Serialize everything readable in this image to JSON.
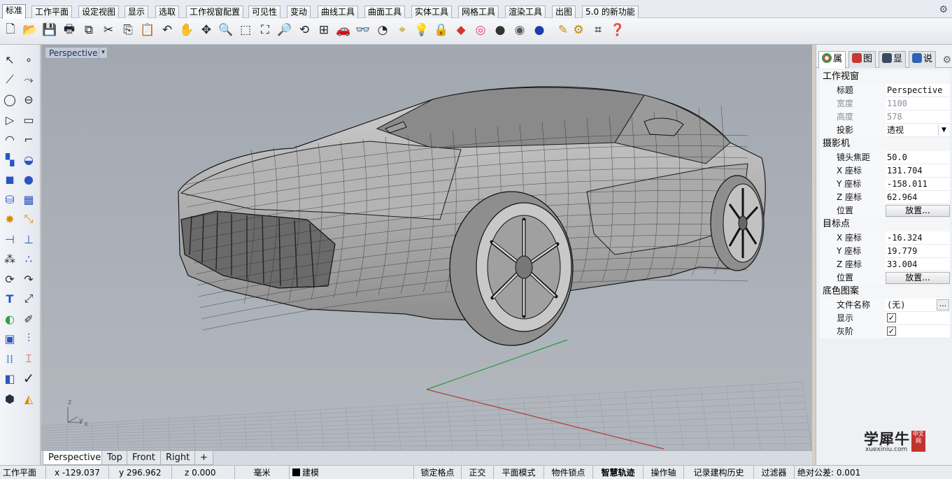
{
  "menu_tabs": [
    {
      "label": "标准",
      "active": true
    },
    {
      "label": "工作平面"
    },
    {
      "label": "设定视图"
    },
    {
      "label": "显示"
    },
    {
      "label": "选取"
    },
    {
      "label": "工作视窗配置"
    },
    {
      "label": "可见性"
    },
    {
      "label": "变动"
    },
    {
      "label": "曲线工具"
    },
    {
      "label": "曲面工具"
    },
    {
      "label": "实体工具"
    },
    {
      "label": "网格工具"
    },
    {
      "label": "渲染工具"
    },
    {
      "label": "出图"
    },
    {
      "label": "5.0 的新功能"
    }
  ],
  "toolbar_icons": [
    "new-file-icon",
    "open-folder-icon",
    "save-icon",
    "print-icon",
    "import-icon",
    "cut-icon",
    "copy-icon",
    "paste-icon",
    "undo-icon",
    "pan-hand-icon",
    "rotate-view-icon",
    "zoom-icon",
    "zoom-window-icon",
    "zoom-extents-icon",
    "zoom-selected-icon",
    "rotate-icon",
    "four-viewports-icon",
    "car-object-icon",
    "named-views-icon",
    "gumball-icon",
    "snap-icon",
    "light-bulb-icon",
    "lock-icon",
    "layer-icon",
    "color-wheel-icon",
    "shaded-sphere-icon",
    "rendered-sphere-icon",
    "render-sphere-icon",
    "highlight-icon",
    "options-gear-icon",
    "dimension-icon",
    "help-icon"
  ],
  "left_toolbar_icons": [
    "select-arrow-icon",
    "point-icon",
    "polyline-icon",
    "curve-icon",
    "circle-icon",
    "ellipse-icon",
    "polygon-icon",
    "rectangle-icon",
    "arc-icon",
    "fillet-curve-icon",
    "surface-icon",
    "patch-surface-icon",
    "box-solid-icon",
    "sphere-solid-icon",
    "cylinder-icon",
    "mesh-icon",
    "explode-icon",
    "trim-icon",
    "split-icon",
    "boolean-icon",
    "group-icon",
    "ungroup-icon",
    "offset-icon",
    "blend-icon",
    "text-icon",
    "dimension-line-icon",
    "history-icon",
    "edit-points-icon",
    "array-icon",
    "align-icon",
    "move-grid-icon",
    "analyze-icon",
    "check-icon",
    "render-icon",
    "shade-icon",
    "boolean-union-icon"
  ],
  "viewport": {
    "title": "Perspective",
    "menu_arrow": "▾",
    "axis_x": "x",
    "axis_y": "y",
    "axis_z": "z",
    "tabs": [
      {
        "label": "Perspective",
        "active": true
      },
      {
        "label": "Top"
      },
      {
        "label": "Front"
      },
      {
        "label": "Right"
      },
      {
        "label": "+"
      }
    ]
  },
  "panel": {
    "tabs": [
      {
        "label": "属",
        "icon": "color-wheel-icon",
        "color": "#e0463a",
        "active": true
      },
      {
        "label": "图",
        "icon": "layers-icon",
        "color": "#c73a32"
      },
      {
        "label": "显",
        "icon": "display-icon",
        "color": "#3b4a61"
      },
      {
        "label": "说",
        "icon": "help-icon",
        "color": "#2f62b3"
      }
    ],
    "sections": {
      "viewport": "工作视窗",
      "camera": "摄影机",
      "target": "目标点",
      "wallpaper": "底色图案"
    },
    "rows": {
      "title": {
        "label": "标题",
        "value": "Perspective"
      },
      "width": {
        "label": "宽度",
        "value": "1100"
      },
      "height": {
        "label": "高度",
        "value": "578"
      },
      "projection": {
        "label": "投影",
        "value": "透视"
      },
      "lens": {
        "label": "镜头焦距",
        "value": "50.0"
      },
      "cam_x": {
        "label": "X 座标",
        "value": "131.704"
      },
      "cam_y": {
        "label": "Y 座标",
        "value": "-158.011"
      },
      "cam_z": {
        "label": "Z 座标",
        "value": "62.964"
      },
      "cam_pos": {
        "label": "位置",
        "button": "放置..."
      },
      "tgt_x": {
        "label": "X 座标",
        "value": "-16.324"
      },
      "tgt_y": {
        "label": "Y 座标",
        "value": "19.779"
      },
      "tgt_z": {
        "label": "Z 座标",
        "value": "33.004"
      },
      "tgt_pos": {
        "label": "位置",
        "button": "放置..."
      },
      "filename": {
        "label": "文件名称",
        "value": "(无)",
        "dots": "..."
      },
      "show": {
        "label": "显示",
        "checked": "✓"
      },
      "gray": {
        "label": "灰阶",
        "checked": "✓"
      }
    }
  },
  "watermark": {
    "main": "学犀牛",
    "sub": "xuexiniu.com",
    "badge": "中文网"
  },
  "status": {
    "cplane": "工作平面",
    "x": "x -129.037",
    "y": "y 296.962",
    "z": "z 0.000",
    "unit": "毫米",
    "layer": "建模",
    "grid_snap": "锁定格点",
    "ortho": "正交",
    "planar": "平面模式",
    "osnap": "物件锁点",
    "smarttrack": "智慧轨迹",
    "gumball": "操作轴",
    "history": "记录建构历史",
    "filter": "过滤器",
    "tolerance": "绝对公差: 0.001"
  }
}
